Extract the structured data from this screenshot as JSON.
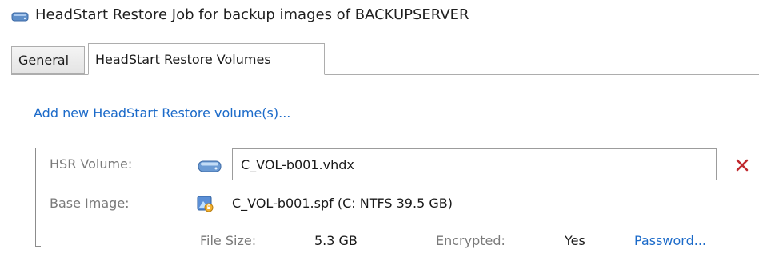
{
  "window": {
    "title": "HeadStart Restore Job for backup images of BACKUPSERVER"
  },
  "tabs": [
    {
      "label": "General",
      "active": false
    },
    {
      "label": "HeadStart Restore Volumes",
      "active": true
    }
  ],
  "add_volume_link": "Add new HeadStart Restore volume(s)...",
  "volume": {
    "hsr_label": "HSR Volume:",
    "hsr_value": "C_VOL-b001.vhdx",
    "base_label": "Base Image:",
    "base_value": "C_VOL-b001.spf (C: NTFS 39.5 GB)",
    "file_size_label": "File Size:",
    "file_size_value": "5.3 GB",
    "encrypted_label": "Encrypted:",
    "encrypted_value": "Yes",
    "password_link": "Password..."
  },
  "icons": {
    "title": "drive-icon",
    "hsr": "drive-icon",
    "base": "backup-image-icon",
    "remove": "close-icon"
  },
  "colors": {
    "link": "#1b6ac9",
    "remove": "#c0282d",
    "label": "#7a7a7a"
  }
}
